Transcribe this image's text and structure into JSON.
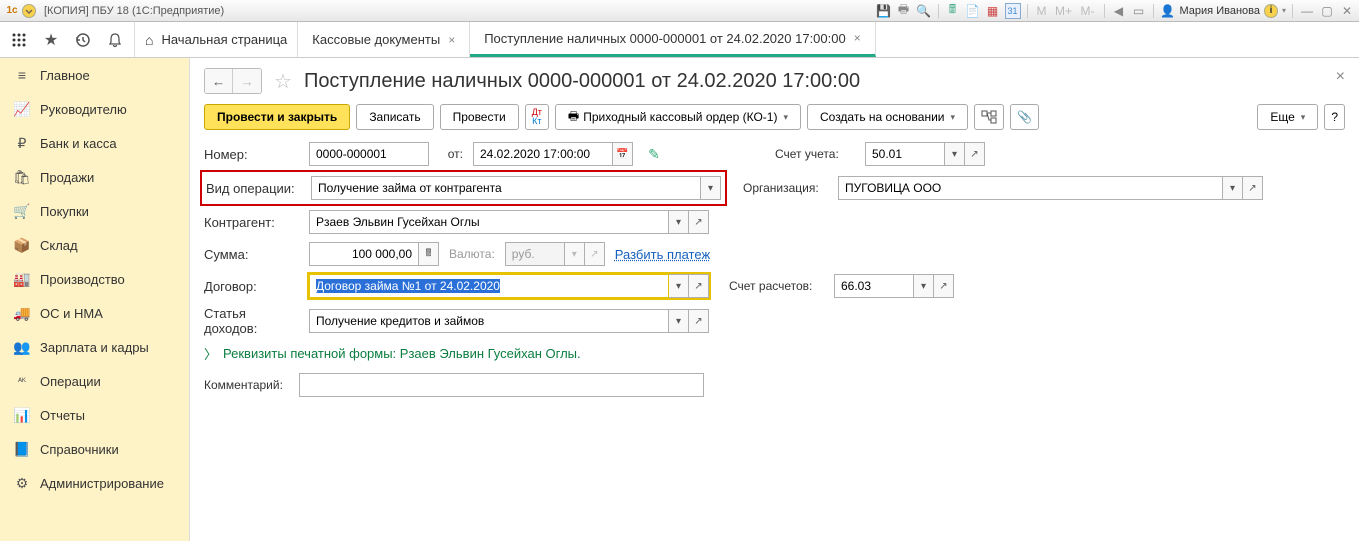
{
  "titlebar": {
    "title": "[КОПИЯ] ПБУ 18  (1С:Предприятие)",
    "user": "Мария Иванова",
    "m_labels": [
      "M",
      "M+",
      "M-"
    ]
  },
  "tabs": {
    "home": "Начальная страница",
    "t1": "Кассовые документы",
    "t2": "Поступление наличных 0000-000001 от 24.02.2020 17:00:00"
  },
  "sidebar": {
    "items": [
      {
        "label": "Главное",
        "icon": "≡"
      },
      {
        "label": "Руководителю",
        "icon": "📈"
      },
      {
        "label": "Банк и касса",
        "icon": "₽"
      },
      {
        "label": "Продажи",
        "icon": "🛍"
      },
      {
        "label": "Покупки",
        "icon": "🛒"
      },
      {
        "label": "Склад",
        "icon": "📦"
      },
      {
        "label": "Производство",
        "icon": "🏭"
      },
      {
        "label": "ОС и НМА",
        "icon": "🚚"
      },
      {
        "label": "Зарплата и кадры",
        "icon": "👥"
      },
      {
        "label": "Операции",
        "icon": "ᴬᴷ"
      },
      {
        "label": "Отчеты",
        "icon": "📊"
      },
      {
        "label": "Справочники",
        "icon": "📘"
      },
      {
        "label": "Администрирование",
        "icon": "⚙"
      }
    ]
  },
  "page": {
    "title": "Поступление наличных 0000-000001 от 24.02.2020 17:00:00"
  },
  "actions": {
    "post_close": "Провести и закрыть",
    "save": "Записать",
    "post": "Провести",
    "dtk": "Дт/Кт",
    "print": "Приходный кассовый ордер (КО-1)",
    "create_based": "Создать на основании",
    "more": "Еще"
  },
  "form": {
    "number_label": "Номер:",
    "number": "0000-000001",
    "from_label": "от:",
    "date": "24.02.2020 17:00:00",
    "account_label": "Счет учета:",
    "account": "50.01",
    "op_type_label": "Вид операции:",
    "op_type": "Получение займа от контрагента",
    "org_label": "Организация:",
    "org": "ПУГОВИЦА ООО",
    "counterparty_label": "Контрагент:",
    "counterparty": "Рзаев Эльвин Гусейхан Оглы",
    "sum_label": "Сумма:",
    "sum": "100 000,00",
    "currency_label": "Валюта:",
    "currency": "руб.",
    "split": "Разбить платеж",
    "contract_label": "Договор:",
    "contract": "Договор займа №1 от 24.02.2020",
    "settle_acc_label": "Счет расчетов:",
    "settle_acc": "66.03",
    "income_label": "Статья доходов:",
    "income": "Получение кредитов и займов",
    "requisites": "Реквизиты печатной формы: Рзаев Эльвин Гусейхан Оглы.",
    "comment_label": "Комментарий:"
  }
}
